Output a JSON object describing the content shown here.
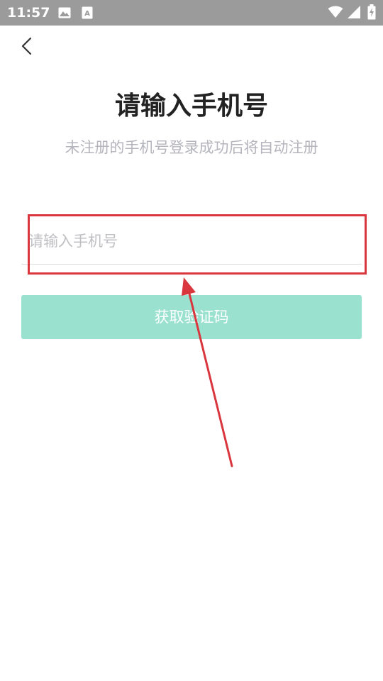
{
  "status_bar": {
    "time": "11:57",
    "left_icons": [
      "image-icon",
      "font-icon"
    ],
    "right_icons": [
      "wifi-icon",
      "signal-icon",
      "battery-charging-icon"
    ],
    "background_color": "#9b9b9b"
  },
  "header": {
    "back_icon": "chevron-left-icon"
  },
  "main": {
    "title": "请输入手机号",
    "subtitle": "未注册的手机号登录成功后将自动注册",
    "phone_input": {
      "value": "",
      "placeholder": "请输入手机号"
    },
    "get_code_button": {
      "label": "获取验证码",
      "color": "#9ae1d0"
    }
  },
  "annotation": {
    "highlight_color": "#d9363e"
  }
}
